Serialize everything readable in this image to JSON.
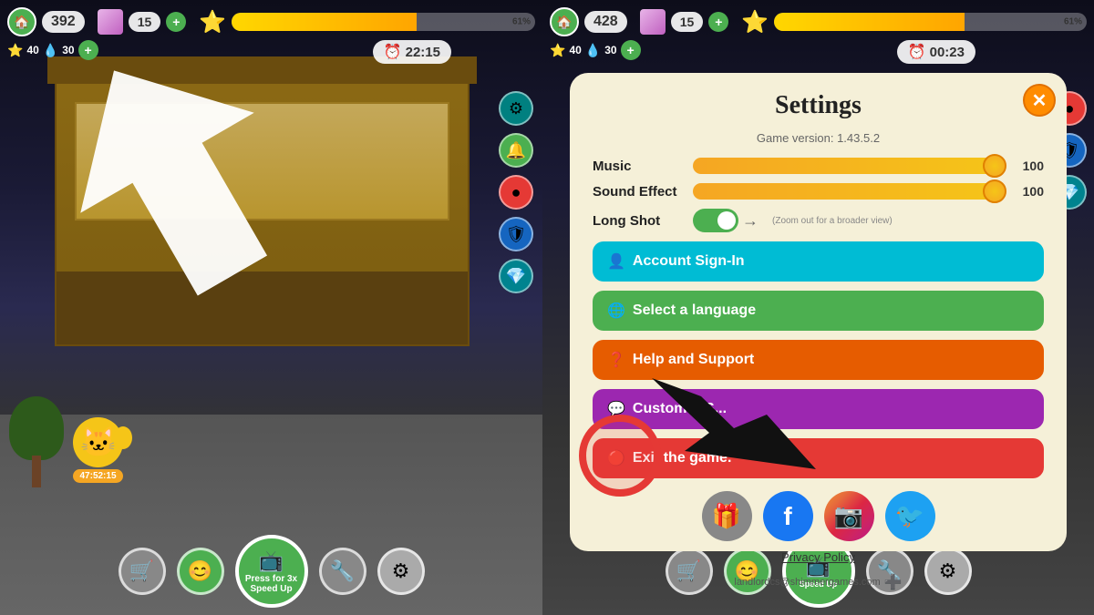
{
  "left": {
    "coins": "392",
    "gems": "15",
    "xp_percent": "61%",
    "sub_stars": "40",
    "sub_water": "30",
    "timer": "22:15",
    "cat_label": "47:52:15",
    "speed_up_label": "Press for 3x\nSpeed Up",
    "speed_up_line1": "Press for 3x",
    "speed_up_line2": "Speed Up"
  },
  "right": {
    "coins": "428",
    "gems": "15",
    "xp_percent": "61%",
    "sub_stars": "40",
    "sub_water": "30",
    "timer": "00:23"
  },
  "settings": {
    "title": "Settings",
    "version": "Game version: 1.43.5.2",
    "close_label": "✕",
    "music_label": "Music",
    "music_value": "100",
    "sound_label": "Sound Effect",
    "sound_value": "100",
    "long_shot_label": "Long Shot",
    "long_shot_sub": "(Zoom out for a broader view)",
    "btn_account": "Account Sign-In",
    "btn_language": "Select a language",
    "btn_help": "Help and Support",
    "btn_customer": "Customer S...",
    "btn_exit": "Exit the game.",
    "privacy_label": "Privacy Policy",
    "email": "landlordcs@shimmergames.com",
    "account_icon": "👤",
    "language_icon": "🌐",
    "help_icon": "❓",
    "customer_icon": "💬",
    "exit_icon": "🔴"
  },
  "icons": {
    "settings": "⚙",
    "notification": "🔔",
    "circle_red": "🔴",
    "gift": "🎁",
    "facebook": "f",
    "instagram": "📷",
    "twitter": "🐦",
    "cart": "🛒",
    "face": "😊",
    "wrench": "🔧",
    "gear": "⚙"
  }
}
